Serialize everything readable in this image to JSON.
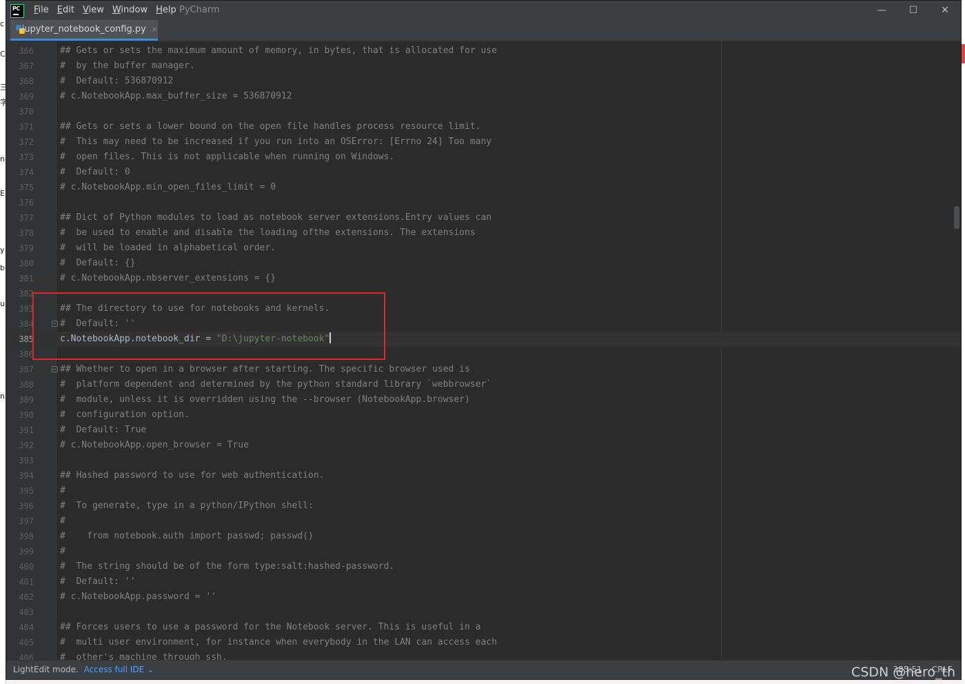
{
  "titlebar": {
    "menu": [
      "File",
      "Edit",
      "View",
      "Window",
      "Help"
    ],
    "menu_underline": [
      "F",
      "E",
      "V",
      "W",
      "H"
    ],
    "app_name": "PyCharm",
    "icon_text": "PC",
    "minimize": "—",
    "maximize": "☐",
    "close": "✕"
  },
  "tab": {
    "filename": "jupyter_notebook_config.py",
    "close": "×"
  },
  "editor": {
    "current_line": 385,
    "lines": [
      {
        "n": "366",
        "t": "## Gets or sets the maximum amount of memory, in bytes, that is allocated for use"
      },
      {
        "n": "367",
        "t": "#  by the buffer manager."
      },
      {
        "n": "368",
        "t": "#  Default: 536870912"
      },
      {
        "n": "369",
        "t": "# c.NotebookApp.max_buffer_size = 536870912"
      },
      {
        "n": "370",
        "t": ""
      },
      {
        "n": "371",
        "t": "## Gets or sets a lower bound on the open file handles process resource limit."
      },
      {
        "n": "372",
        "t": "#  This may need to be increased if you run into an OSError: [Errno 24] Too many"
      },
      {
        "n": "373",
        "t": "#  open files. This is not applicable when running on Windows."
      },
      {
        "n": "374",
        "t": "#  Default: 0"
      },
      {
        "n": "375",
        "t": "# c.NotebookApp.min_open_files_limit = 0"
      },
      {
        "n": "376",
        "t": ""
      },
      {
        "n": "377",
        "t": "## Dict of Python modules to load as notebook server extensions.Entry values can"
      },
      {
        "n": "378",
        "t": "#  be used to enable and disable the loading ofthe extensions. The extensions"
      },
      {
        "n": "379",
        "t": "#  will be loaded in alphabetical order."
      },
      {
        "n": "380",
        "t": "#  Default: {}"
      },
      {
        "n": "381",
        "t": "# c.NotebookApp.nbserver_extensions = {}"
      },
      {
        "n": "382",
        "t": ""
      },
      {
        "n": "383",
        "t": "## The directory to use for notebooks and kernels."
      },
      {
        "n": "384",
        "t": "#  Default: ''"
      },
      {
        "n": "385",
        "t": "",
        "code_id": "c.NotebookApp.notebook_dir = ",
        "code_str": "\"D:\\jupyter-notebook\""
      },
      {
        "n": "386",
        "t": ""
      },
      {
        "n": "387",
        "t": "## Whether to open in a browser after starting. The specific browser used is"
      },
      {
        "n": "388",
        "t": "#  platform dependent and determined by the python standard library `webbrowser`"
      },
      {
        "n": "389",
        "t": "#  module, unless it is overridden using the --browser (NotebookApp.browser)"
      },
      {
        "n": "390",
        "t": "#  configuration option."
      },
      {
        "n": "391",
        "t": "#  Default: True"
      },
      {
        "n": "392",
        "t": "# c.NotebookApp.open_browser = True"
      },
      {
        "n": "393",
        "t": ""
      },
      {
        "n": "394",
        "t": "## Hashed password to use for web authentication."
      },
      {
        "n": "395",
        "t": "#"
      },
      {
        "n": "396",
        "t": "#  To generate, type in a python/IPython shell:"
      },
      {
        "n": "397",
        "t": "#"
      },
      {
        "n": "398",
        "t": "#    from notebook.auth import passwd; passwd()"
      },
      {
        "n": "399",
        "t": "#"
      },
      {
        "n": "400",
        "t": "#  The string should be of the form type:salt:hashed-password."
      },
      {
        "n": "401",
        "t": "#  Default: ''"
      },
      {
        "n": "402",
        "t": "# c.NotebookApp.password = ''"
      },
      {
        "n": "403",
        "t": ""
      },
      {
        "n": "404",
        "t": "## Forces users to use a password for the Notebook server. This is useful in a"
      },
      {
        "n": "405",
        "t": "#  multi user environment, for instance when everybody in the LAN can access each"
      },
      {
        "n": "406",
        "t": "#  other's machine through ssh."
      }
    ]
  },
  "statusbar": {
    "mode": "LightEdit mode.",
    "link": "Access full IDE",
    "link_chevron": "⌄",
    "position": "385:51",
    "line_sep": "CRLF"
  },
  "watermark": "CSDN @hero_th",
  "left_strip": [
    "c",
    "C",
    "三",
    "字",
    "n",
    "E",
    "y",
    "b",
    "u",
    "n"
  ]
}
